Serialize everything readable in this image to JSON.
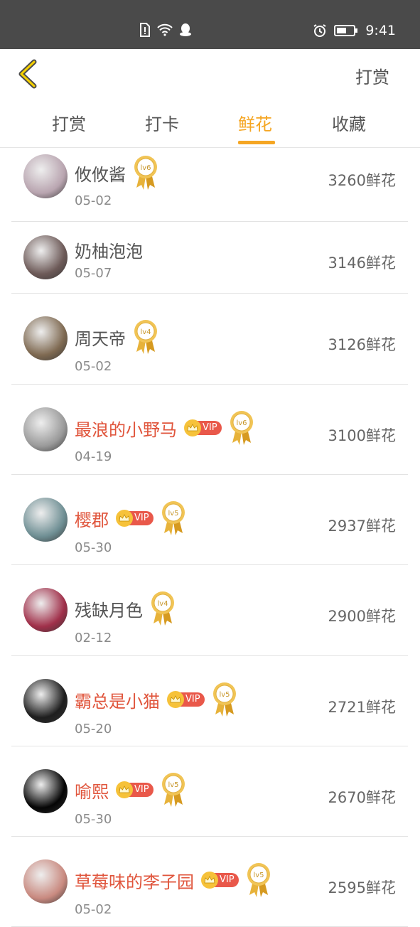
{
  "status_bar": {
    "time": "9:41",
    "colors": {
      "bg": "#4a4a4a"
    }
  },
  "header": {
    "right_label": "打赏"
  },
  "tabs": [
    {
      "label": "打赏",
      "active": false
    },
    {
      "label": "打卡",
      "active": false
    },
    {
      "label": "鲜花",
      "active": true
    },
    {
      "label": "收藏",
      "active": false
    }
  ],
  "colors": {
    "accent": "#f5a623",
    "vip_name": "#e0553c",
    "text": "#555555"
  },
  "rows": [
    {
      "name": "攸攸酱",
      "date": "05-02",
      "amount": "3260鲜花",
      "vip": false,
      "level": "lv6",
      "avatar": "#b9a5b0"
    },
    {
      "name": "奶柚泡泡",
      "date": "05-07",
      "amount": "3146鲜花",
      "vip": false,
      "level": "",
      "avatar": "#6d5a58"
    },
    {
      "name": "周天帝",
      "date": "05-02",
      "amount": "3126鲜花",
      "vip": false,
      "level": "lv4",
      "avatar": "#7f6a52"
    },
    {
      "name": "最浪的小野马",
      "date": "04-19",
      "amount": "3100鲜花",
      "vip": true,
      "level": "lv6",
      "avatar": "#9a9a9a"
    },
    {
      "name": "樱郡",
      "date": "05-30",
      "amount": "2937鲜花",
      "vip": true,
      "level": "lv5",
      "avatar": "#6f8f94"
    },
    {
      "name": "残缺月色",
      "date": "02-12",
      "amount": "2900鲜花",
      "vip": false,
      "level": "lv4",
      "avatar": "#a0304a"
    },
    {
      "name": "霸总是小猫",
      "date": "05-20",
      "amount": "2721鲜花",
      "vip": true,
      "level": "lv5",
      "avatar": "#1e1e1e"
    },
    {
      "name": "喻熙",
      "date": "05-30",
      "amount": "2670鲜花",
      "vip": true,
      "level": "lv5",
      "avatar": "#050505"
    },
    {
      "name": "草莓味的李子园",
      "date": "05-02",
      "amount": "2595鲜花",
      "vip": true,
      "level": "lv5",
      "avatar": "#c98a80"
    }
  ],
  "vip_label": "VIP"
}
